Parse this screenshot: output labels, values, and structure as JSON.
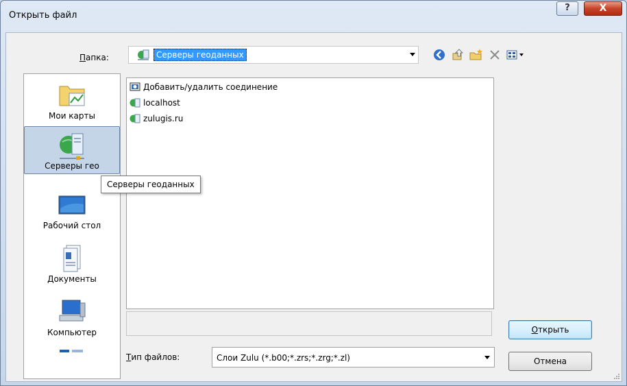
{
  "window": {
    "title": "Открыть файл",
    "help_label": "?",
    "close_label": "X"
  },
  "folder": {
    "label_prefix": "",
    "label_accel": "П",
    "label_rest": "апка:",
    "selected": "Серверы геоданных"
  },
  "toolbar": {
    "back": "back-icon",
    "up": "up-folder-icon",
    "new_folder": "new-folder-icon",
    "delete": "delete-icon",
    "views": "view-menu-icon"
  },
  "places": [
    {
      "label": "Мои карты",
      "icon": "my-maps-icon"
    },
    {
      "label": "Серверы гео",
      "icon": "geodata-servers-icon",
      "selected": true
    },
    {
      "label": "Рабочий стол",
      "icon": "desktop-icon"
    },
    {
      "label": "Документы",
      "icon": "documents-icon"
    },
    {
      "label": "Компьютер",
      "icon": "computer-icon"
    }
  ],
  "files": [
    {
      "label": "Добавить/удалить соединение",
      "icon": "add-connection-icon"
    },
    {
      "label": "localhost",
      "icon": "server-icon"
    },
    {
      "label": "zulugis.ru",
      "icon": "server-icon"
    }
  ],
  "tooltip": "Серверы геоданных",
  "file_type": {
    "label_accel": "Т",
    "label_rest": "ип файлов:",
    "value": "Слои Zulu (*.b00;*.zrs;*.zrg;*.zl)"
  },
  "buttons": {
    "open_accel": "О",
    "open_rest": "ткрыть",
    "cancel": "Отмена"
  },
  "colors": {
    "selection": "#3399ff",
    "close_red": "#c6442a",
    "place_selected": "#c5d5e8"
  }
}
